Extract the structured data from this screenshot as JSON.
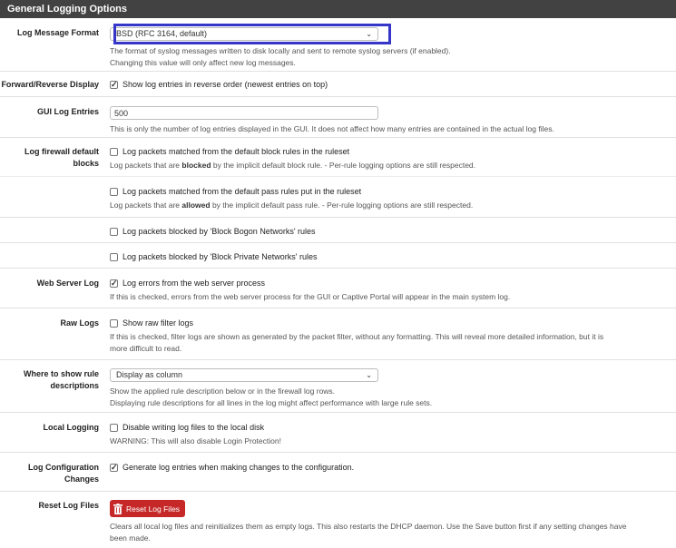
{
  "panel": {
    "title": "General Logging Options"
  },
  "log_message_format": {
    "label": "Log Message Format",
    "value": "BSD (RFC 3164, default)",
    "help1": "The format of syslog messages written to disk locally and sent to remote syslog servers (if enabled).",
    "help2": "Changing this value will only affect new log messages."
  },
  "forward_reverse": {
    "label": "Forward/Reverse Display",
    "checked": true,
    "text": "Show log entries in reverse order (newest entries on top)"
  },
  "gui_log_entries": {
    "label": "GUI Log Entries",
    "value": "500",
    "help": "This is only the number of log entries displayed in the GUI. It does not affect how many entries are contained in the actual log files."
  },
  "firewall_default": {
    "label1": "Log firewall default",
    "label2": "blocks",
    "block_text": "Log packets matched from the default block rules in the ruleset",
    "block_help_pre": "Log packets that are ",
    "block_help_bold": "blocked",
    "block_help_post": " by the implicit default block rule. - Per-rule logging options are still respected.",
    "pass_text": "Log packets matched from the default pass rules put in the ruleset",
    "pass_help_pre": "Log packets that are ",
    "pass_help_bold": "allowed",
    "pass_help_post": " by the implicit default pass rule. - Per-rule logging options are still respected.",
    "bogon_text": "Log packets blocked by 'Block Bogon Networks' rules",
    "private_text": "Log packets blocked by 'Block Private Networks' rules"
  },
  "web_server_log": {
    "label": "Web Server Log",
    "checked": true,
    "text": "Log errors from the web server process",
    "help": "If this is checked, errors from the web server process for the GUI or Captive Portal will appear in the main system log."
  },
  "raw_logs": {
    "label": "Raw Logs",
    "text": "Show raw filter logs",
    "help1": "If this is checked, filter logs are shown as generated by the packet filter, without any formatting. This will reveal more detailed information, but it is",
    "help2": "more difficult to read."
  },
  "rule_descriptions": {
    "label1": "Where to show rule",
    "label2": "descriptions",
    "value": "Display as column",
    "help1": "Show the applied rule description below or in the firewall log rows.",
    "help2": "Displaying rule descriptions for all lines in the log might affect performance with large rule sets."
  },
  "local_logging": {
    "label": "Local Logging",
    "text": "Disable writing log files to the local disk",
    "help": "WARNING: This will also disable Login Protection!"
  },
  "config_changes": {
    "label1": "Log Configuration",
    "label2": "Changes",
    "checked": true,
    "text": "Generate log entries when making changes to the configuration."
  },
  "reset_log_files": {
    "label": "Reset Log Files",
    "button": "Reset Log Files",
    "help1": "Clears all local log files and reinitializes them as empty logs. This also restarts the DHCP daemon. Use the Save button first if any setting changes have",
    "help2": "been made."
  },
  "colors": {
    "heading": "#424242",
    "highlight": "#3535c8",
    "danger": "#c62828"
  }
}
